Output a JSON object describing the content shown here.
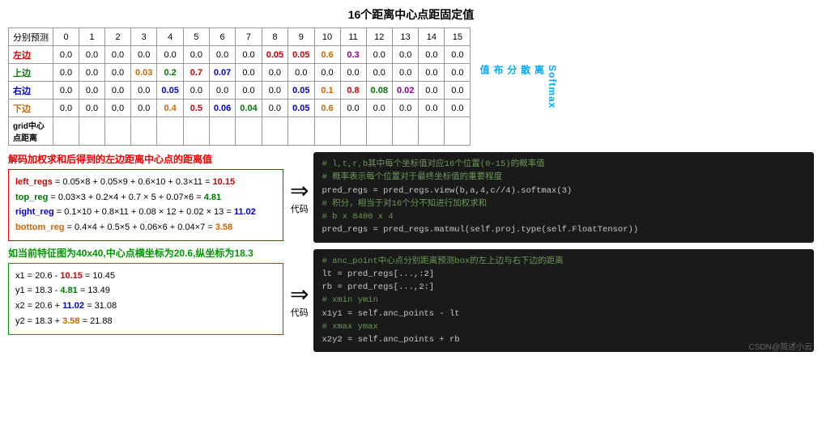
{
  "title": "16个距离中心点距固定值",
  "table": {
    "header_label": "分别预测",
    "columns": [
      "0",
      "1",
      "2",
      "3",
      "4",
      "5",
      "6",
      "7",
      "8",
      "9",
      "10",
      "11",
      "12",
      "13",
      "14",
      "15"
    ],
    "rows": [
      {
        "label": "左边",
        "label_color": "red",
        "cells": [
          {
            "v": "0.0",
            "c": ""
          },
          {
            "v": "0.0",
            "c": ""
          },
          {
            "v": "0.0",
            "c": ""
          },
          {
            "v": "0.0",
            "c": ""
          },
          {
            "v": "0.0",
            "c": ""
          },
          {
            "v": "0.0",
            "c": ""
          },
          {
            "v": "0.0",
            "c": ""
          },
          {
            "v": "0.0",
            "c": ""
          },
          {
            "v": "0.05",
            "c": "red"
          },
          {
            "v": "0.05",
            "c": "red"
          },
          {
            "v": "0.6",
            "c": "orange"
          },
          {
            "v": "0.3",
            "c": "purple"
          },
          {
            "v": "0.0",
            "c": ""
          },
          {
            "v": "0.0",
            "c": ""
          },
          {
            "v": "0.0",
            "c": ""
          },
          {
            "v": "0.0",
            "c": ""
          }
        ]
      },
      {
        "label": "上边",
        "label_color": "green",
        "cells": [
          {
            "v": "0.0",
            "c": ""
          },
          {
            "v": "0.0",
            "c": ""
          },
          {
            "v": "0.0",
            "c": ""
          },
          {
            "v": "0.03",
            "c": "orange"
          },
          {
            "v": "0.2",
            "c": "green"
          },
          {
            "v": "0.7",
            "c": "red"
          },
          {
            "v": "0.07",
            "c": "blue"
          },
          {
            "v": "0.0",
            "c": ""
          },
          {
            "v": "0.0",
            "c": ""
          },
          {
            "v": "0.0",
            "c": ""
          },
          {
            "v": "0.0",
            "c": ""
          },
          {
            "v": "0.0",
            "c": ""
          },
          {
            "v": "0.0",
            "c": ""
          },
          {
            "v": "0.0",
            "c": ""
          },
          {
            "v": "0.0",
            "c": ""
          },
          {
            "v": "0.0",
            "c": ""
          }
        ]
      },
      {
        "label": "右边",
        "label_color": "blue",
        "cells": [
          {
            "v": "0.0",
            "c": ""
          },
          {
            "v": "0.0",
            "c": ""
          },
          {
            "v": "0.0",
            "c": ""
          },
          {
            "v": "0.0",
            "c": ""
          },
          {
            "v": "0.05",
            "c": "blue"
          },
          {
            "v": "0.0",
            "c": ""
          },
          {
            "v": "0.0",
            "c": ""
          },
          {
            "v": "0.0",
            "c": ""
          },
          {
            "v": "0.0",
            "c": ""
          },
          {
            "v": "0.05",
            "c": "blue"
          },
          {
            "v": "0.1",
            "c": "orange"
          },
          {
            "v": "0.8",
            "c": "red"
          },
          {
            "v": "0.08",
            "c": "green"
          },
          {
            "v": "0.02",
            "c": "purple"
          },
          {
            "v": "0.0",
            "c": ""
          },
          {
            "v": "0.0",
            "c": ""
          }
        ]
      },
      {
        "label": "下边",
        "label_color": "orange",
        "cells": [
          {
            "v": "0.0",
            "c": ""
          },
          {
            "v": "0.0",
            "c": ""
          },
          {
            "v": "0.0",
            "c": ""
          },
          {
            "v": "0.0",
            "c": ""
          },
          {
            "v": "0.4",
            "c": "orange"
          },
          {
            "v": "0.5",
            "c": "red"
          },
          {
            "v": "0.06",
            "c": "blue"
          },
          {
            "v": "0.04",
            "c": "green"
          },
          {
            "v": "0.0",
            "c": ""
          },
          {
            "v": "0.05",
            "c": "blue"
          },
          {
            "v": "0.6",
            "c": "orange"
          },
          {
            "v": "0.0",
            "c": ""
          },
          {
            "v": "0.0",
            "c": ""
          },
          {
            "v": "0.0",
            "c": ""
          },
          {
            "v": "0.0",
            "c": ""
          },
          {
            "v": "0.0",
            "c": ""
          }
        ]
      },
      {
        "label": "grid中心\n点距离",
        "label_color": "black",
        "cells": [
          {
            "v": "",
            "c": ""
          },
          {
            "v": "",
            "c": ""
          },
          {
            "v": "",
            "c": ""
          },
          {
            "v": "",
            "c": ""
          },
          {
            "v": "",
            "c": ""
          },
          {
            "v": "",
            "c": ""
          },
          {
            "v": "",
            "c": ""
          },
          {
            "v": "",
            "c": ""
          },
          {
            "v": "",
            "c": ""
          },
          {
            "v": "",
            "c": ""
          },
          {
            "v": "",
            "c": ""
          },
          {
            "v": "",
            "c": ""
          },
          {
            "v": "",
            "c": ""
          },
          {
            "v": "",
            "c": ""
          },
          {
            "v": "",
            "c": ""
          },
          {
            "v": "",
            "c": ""
          }
        ]
      }
    ]
  },
  "softmax_label": "Softmax\n离\n散\n分\n布\n值",
  "decode": {
    "title": "解码加权求和后得到的左边距离中心点的距离值",
    "formulas": [
      {
        "parts": [
          {
            "t": "left_regs",
            "c": "red"
          },
          {
            "t": " = 0.05×8 + 0.05×9 + 0.6×10 + 0.3×11 = ",
            "c": "black"
          },
          {
            "t": "10.15",
            "c": "red"
          }
        ]
      },
      {
        "parts": [
          {
            "t": "top_reg",
            "c": "green"
          },
          {
            "t": " = 0.03×3 + 0.2×4 + 0.7 × 5 + 0.07×6 = ",
            "c": "black"
          },
          {
            "t": "4.81",
            "c": "green"
          }
        ]
      },
      {
        "parts": [
          {
            "t": "right_reg",
            "c": "blue"
          },
          {
            "t": " = 0.1×10 + 0.8×11 + 0.08 × 12 + 0.02 × 13 = ",
            "c": "black"
          },
          {
            "t": "11.02",
            "c": "blue"
          }
        ]
      },
      {
        "parts": [
          {
            "t": "bottom_reg",
            "c": "orange"
          },
          {
            "t": " = 0.4×4 + 0.5×5 + 0.06×6 + 0.04×7 = ",
            "c": "black"
          },
          {
            "t": "3.58",
            "c": "orange"
          }
        ]
      }
    ]
  },
  "feature": {
    "title": "如当前特征图为40x40,中心点横坐标为20.6,纵坐标为18.3",
    "coords": [
      {
        "parts": [
          {
            "t": "x1 = 20.6 - ",
            "c": "black"
          },
          {
            "t": "10.15",
            "c": "red"
          },
          {
            "t": " = 10.45",
            "c": "black"
          }
        ]
      },
      {
        "parts": [
          {
            "t": "y1 = 18.3 - ",
            "c": "black"
          },
          {
            "t": "4.81",
            "c": "green"
          },
          {
            "t": " = 13.49",
            "c": "black"
          }
        ]
      },
      {
        "parts": [
          {
            "t": "x2 = 20.6 + ",
            "c": "black"
          },
          {
            "t": "11.02",
            "c": "blue"
          },
          {
            "t": " = 31.08",
            "c": "black"
          }
        ]
      },
      {
        "parts": [
          {
            "t": "y2 = 18.3 + ",
            "c": "black"
          },
          {
            "t": "3.58",
            "c": "orange"
          },
          {
            "t": " = 21.88",
            "c": "black"
          }
        ]
      }
    ]
  },
  "code_blocks": [
    {
      "arrow": "代码",
      "lines": [
        {
          "t": "# l,t,r,b其中每个坐标值对应16个位置(0-15)的概率值",
          "c": "comment"
        },
        {
          "t": "# 概率表示每个位置对于最终坐标值的重要程度",
          "c": "comment"
        },
        {
          "t": "pred_regs = pred_regs.view(b,a,4,c//4).softmax(3)",
          "c": "code"
        },
        {
          "t": "# 积分，相当于对16个分不知进行加权求和",
          "c": "comment"
        },
        {
          "t": "# b x 8400 x 4",
          "c": "comment"
        },
        {
          "t": "pred_regs = pred_regs.matmul(self.proj.type(self.FloatTensor))",
          "c": "code"
        }
      ]
    },
    {
      "arrow": "代码",
      "lines": [
        {
          "t": "# anc_point中心点分别距离预测box的左上边与右下边的距离",
          "c": "comment"
        },
        {
          "t": "lt = pred_regs[...,:2]",
          "c": "code"
        },
        {
          "t": "rb = pred_regs[...,2:]",
          "c": "code"
        },
        {
          "t": "# xmin ymin",
          "c": "comment"
        },
        {
          "t": "x1y1 = self.anc_points - lt",
          "c": "code"
        },
        {
          "t": "# xmax ymax",
          "c": "comment"
        },
        {
          "t": "x2y2 = self.anc_points + rb",
          "c": "code"
        }
      ]
    }
  ],
  "watermark": "CSDN@简述小云"
}
